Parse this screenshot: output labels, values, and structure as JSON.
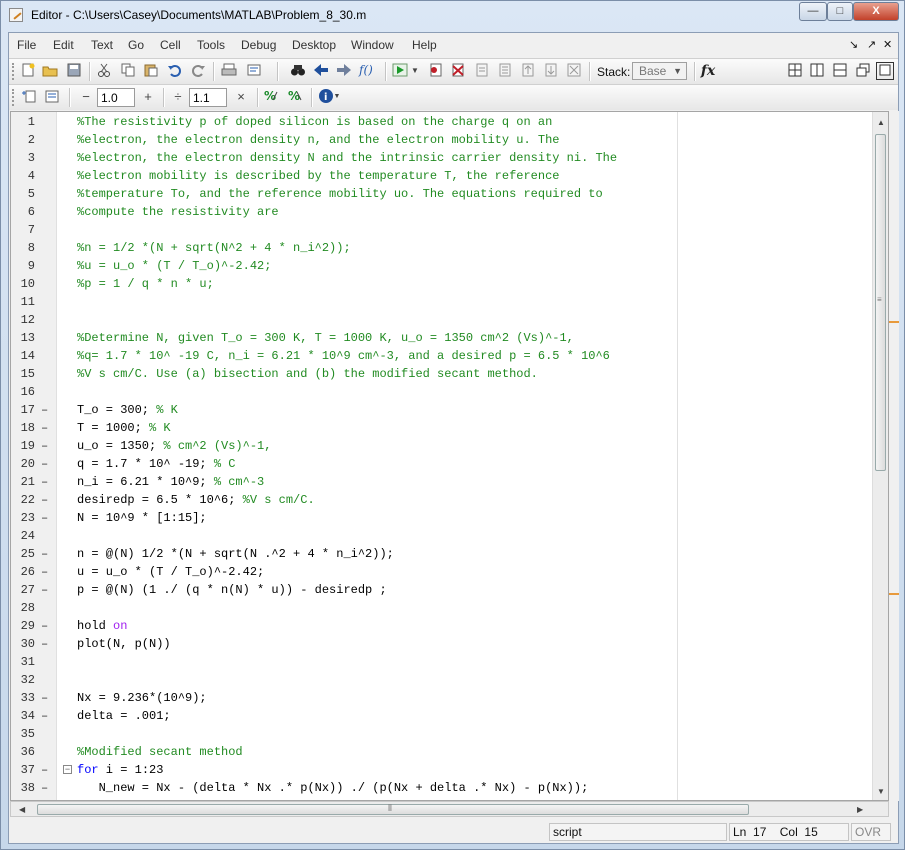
{
  "window": {
    "title": "Editor - C:\\Users\\Casey\\Documents\\MATLAB\\Problem_8_30.m",
    "controls": {
      "minimize": "—",
      "maximize": "□",
      "close": "X"
    }
  },
  "menubar": {
    "items": [
      "File",
      "Edit",
      "Text",
      "Go",
      "Cell",
      "Tools",
      "Debug",
      "Desktop",
      "Window",
      "Help"
    ],
    "right": {
      "undock": "↘",
      "pin": "↗",
      "close": "✕"
    }
  },
  "toolbar": {
    "stack_label": "Stack:",
    "stack_value": "Base",
    "fx_label": "fx"
  },
  "cell_toolbar": {
    "minus": "−",
    "value1": "1.0",
    "plus": "+",
    "divide": "÷",
    "value2": "1.1",
    "times": "×"
  },
  "code_lines": [
    {
      "n": "1",
      "exec": false,
      "fold": false,
      "text": "%The resistivity p of doped silicon is based on the charge q on an",
      "type": "comment"
    },
    {
      "n": "2",
      "exec": false,
      "fold": false,
      "text": "%electron, the electron density n, and the electron mobility u. The",
      "type": "comment"
    },
    {
      "n": "3",
      "exec": false,
      "fold": false,
      "text": "%electron, the electron density N and the intrinsic carrier density ni. The",
      "type": "comment"
    },
    {
      "n": "4",
      "exec": false,
      "fold": false,
      "text": "%electron mobility is described by the temperature T, the reference",
      "type": "comment"
    },
    {
      "n": "5",
      "exec": false,
      "fold": false,
      "text": "%temperature To, and the reference mobility uo. The equations required to",
      "type": "comment"
    },
    {
      "n": "6",
      "exec": false,
      "fold": false,
      "text": "%compute the resistivity are",
      "type": "comment"
    },
    {
      "n": "7",
      "exec": false,
      "fold": false,
      "text": "",
      "type": "code"
    },
    {
      "n": "8",
      "exec": false,
      "fold": false,
      "text": "%n = 1/2 *(N + sqrt(N^2 + 4 * n_i^2));",
      "type": "comment"
    },
    {
      "n": "9",
      "exec": false,
      "fold": false,
      "text": "%u = u_o * (T / T_o)^-2.42;",
      "type": "comment"
    },
    {
      "n": "10",
      "exec": false,
      "fold": false,
      "text": "%p = 1 / q * n * u;",
      "type": "comment"
    },
    {
      "n": "11",
      "exec": false,
      "fold": false,
      "text": "",
      "type": "code"
    },
    {
      "n": "12",
      "exec": false,
      "fold": false,
      "text": "",
      "type": "code"
    },
    {
      "n": "13",
      "exec": false,
      "fold": false,
      "text": "%Determine N, given T_o = 300 K, T = 1000 K, u_o = 1350 cm^2 (Vs)^-1,",
      "type": "comment"
    },
    {
      "n": "14",
      "exec": false,
      "fold": false,
      "text": "%q= 1.7 * 10^ -19 C, n_i = 6.21 * 10^9 cm^-3, and a desired p = 6.5 * 10^6",
      "type": "comment"
    },
    {
      "n": "15",
      "exec": false,
      "fold": false,
      "text": "%V s cm/C. Use (a) bisection and (b) the modified secant method.",
      "type": "comment"
    },
    {
      "n": "16",
      "exec": false,
      "fold": false,
      "text": "",
      "type": "code"
    },
    {
      "n": "17",
      "exec": true,
      "fold": false,
      "text": "T_o = 300; ",
      "tail": "% K",
      "type": "code"
    },
    {
      "n": "18",
      "exec": true,
      "fold": false,
      "text": "T = 1000; ",
      "tail": "% K",
      "type": "code"
    },
    {
      "n": "19",
      "exec": true,
      "fold": false,
      "text": "u_o = 1350; ",
      "tail": "% cm^2 (Vs)^-1,",
      "type": "code"
    },
    {
      "n": "20",
      "exec": true,
      "fold": false,
      "text": "q = 1.7 * 10^ -19; ",
      "tail": "% C",
      "type": "code"
    },
    {
      "n": "21",
      "exec": true,
      "fold": false,
      "text": "n_i = 6.21 * 10^9; ",
      "tail": "% cm^-3",
      "type": "code"
    },
    {
      "n": "22",
      "exec": true,
      "fold": false,
      "text": "desiredp = 6.5 * 10^6; ",
      "tail": "%V s cm/C.",
      "type": "code"
    },
    {
      "n": "23",
      "exec": true,
      "fold": false,
      "text": "N = 10^9 * [1:15];",
      "type": "code"
    },
    {
      "n": "24",
      "exec": false,
      "fold": false,
      "text": "",
      "type": "code"
    },
    {
      "n": "25",
      "exec": true,
      "fold": false,
      "text": "n = @(N) 1/2 *(N + sqrt(N .^2 + 4 * n_i^2));",
      "type": "code"
    },
    {
      "n": "26",
      "exec": true,
      "fold": false,
      "text": "u = u_o * (T / T_o)^-2.42;",
      "type": "code"
    },
    {
      "n": "27",
      "exec": true,
      "fold": false,
      "text": "p = @(N) (1 ./ (q * n(N) * u)) - desiredp ;",
      "type": "code"
    },
    {
      "n": "28",
      "exec": false,
      "fold": false,
      "text": "",
      "type": "code"
    },
    {
      "n": "29",
      "exec": true,
      "fold": false,
      "text": "hold ",
      "kwtail": "on",
      "type": "code"
    },
    {
      "n": "30",
      "exec": true,
      "fold": false,
      "text": "plot(N, p(N))",
      "type": "code"
    },
    {
      "n": "31",
      "exec": false,
      "fold": false,
      "text": "",
      "type": "code"
    },
    {
      "n": "32",
      "exec": false,
      "fold": false,
      "text": "",
      "type": "code"
    },
    {
      "n": "33",
      "exec": true,
      "fold": false,
      "text": "Nx = 9.236*(10^9);",
      "type": "code"
    },
    {
      "n": "34",
      "exec": true,
      "fold": false,
      "text": "delta = .001;",
      "type": "code"
    },
    {
      "n": "35",
      "exec": false,
      "fold": false,
      "text": "",
      "type": "code"
    },
    {
      "n": "36",
      "exec": false,
      "fold": false,
      "text": "%Modified secant method",
      "type": "comment"
    },
    {
      "n": "37",
      "exec": true,
      "fold": true,
      "kwhead": "for",
      "text": " i = 1:23",
      "type": "code"
    },
    {
      "n": "38",
      "exec": true,
      "fold": false,
      "text": "   N_new = Nx - (delta * Nx .* p(Nx)) ./ (p(Nx + delta .* Nx) - p(Nx));",
      "type": "code"
    }
  ],
  "statusbar": {
    "mode": "script",
    "ln_label": "Ln",
    "ln_value": "17",
    "col_label": "Col",
    "col_value": "15",
    "ovr": "OVR"
  }
}
